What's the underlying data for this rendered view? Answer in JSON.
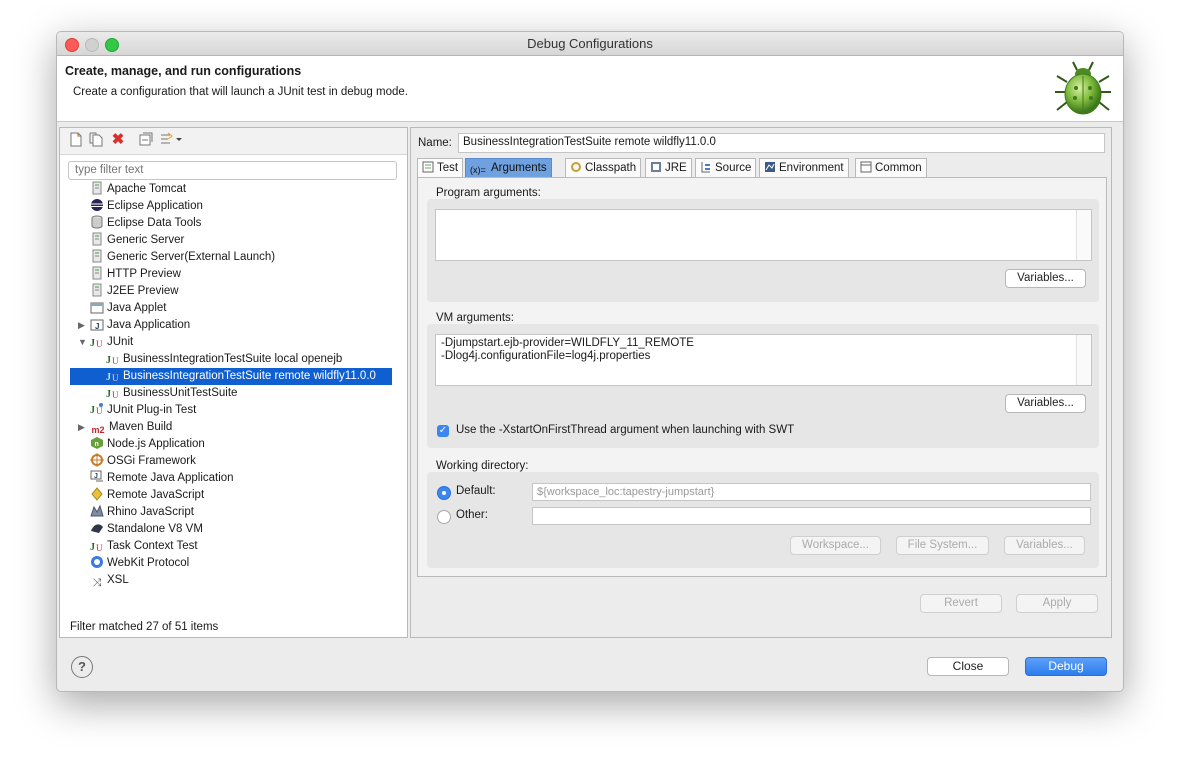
{
  "window": {
    "title": "Debug Configurations"
  },
  "header": {
    "title": "Create, manage, and run configurations",
    "description": "Create a configuration that will launch a JUnit test in debug mode."
  },
  "left": {
    "filter_placeholder": "type filter text",
    "tree": [
      {
        "label": "Apache Tomcat",
        "icon": "server-icon",
        "level": 0
      },
      {
        "label": "Eclipse Application",
        "icon": "eclipse-icon",
        "level": 0
      },
      {
        "label": "Eclipse Data Tools",
        "icon": "database-icon",
        "level": 0
      },
      {
        "label": "Generic Server",
        "icon": "server-icon",
        "level": 0
      },
      {
        "label": "Generic Server(External Launch)",
        "icon": "server-icon",
        "level": 0
      },
      {
        "label": "HTTP Preview",
        "icon": "server-icon",
        "level": 0
      },
      {
        "label": "J2EE Preview",
        "icon": "server-icon",
        "level": 0
      },
      {
        "label": "Java Applet",
        "icon": "applet-icon",
        "level": 0
      },
      {
        "label": "Java Application",
        "icon": "java-app-icon",
        "level": 0,
        "expandable": true
      },
      {
        "label": "JUnit",
        "icon": "junit-icon",
        "level": 0,
        "expanded": true
      },
      {
        "label": "BusinessIntegrationTestSuite local openejb",
        "icon": "junit-icon",
        "level": 1
      },
      {
        "label": "BusinessIntegrationTestSuite remote wildfly11.0.0",
        "icon": "junit-icon",
        "level": 1,
        "selected": true
      },
      {
        "label": "BusinessUnitTestSuite",
        "icon": "junit-icon",
        "level": 1
      },
      {
        "label": "JUnit Plug-in Test",
        "icon": "junit-plugin-icon",
        "level": 0
      },
      {
        "label": "Maven Build",
        "icon": "maven-icon",
        "level": 0,
        "expandable": true
      },
      {
        "label": "Node.js Application",
        "icon": "nodejs-icon",
        "level": 0
      },
      {
        "label": "OSGi Framework",
        "icon": "osgi-icon",
        "level": 0
      },
      {
        "label": "Remote Java Application",
        "icon": "remote-java-icon",
        "level": 0
      },
      {
        "label": "Remote JavaScript",
        "icon": "remote-js-icon",
        "level": 0
      },
      {
        "label": "Rhino JavaScript",
        "icon": "rhino-icon",
        "level": 0
      },
      {
        "label": "Standalone V8 VM",
        "icon": "v8-icon",
        "level": 0
      },
      {
        "label": "Task Context Test",
        "icon": "junit-icon",
        "level": 0
      },
      {
        "label": "WebKit Protocol",
        "icon": "webkit-icon",
        "level": 0
      },
      {
        "label": "XSL",
        "icon": "xsl-icon",
        "level": 0
      }
    ],
    "filter_status": "Filter matched 27 of 51 items"
  },
  "right": {
    "name_label": "Name:",
    "name_value": "BusinessIntegrationTestSuite remote wildfly11.0.0",
    "tabs": [
      {
        "label": "Test",
        "icon": "test-tab-icon"
      },
      {
        "label": "Arguments",
        "icon": "arguments-tab-icon",
        "active": true
      },
      {
        "label": "Classpath",
        "icon": "classpath-tab-icon"
      },
      {
        "label": "JRE",
        "icon": "jre-tab-icon"
      },
      {
        "label": "Source",
        "icon": "source-tab-icon"
      },
      {
        "label": "Environment",
        "icon": "environment-tab-icon"
      },
      {
        "label": "Common",
        "icon": "common-tab-icon"
      }
    ],
    "program_args_label": "Program arguments:",
    "program_args_value": "",
    "variables_label": "Variables...",
    "vm_args_label": "VM arguments:",
    "vm_args_value": "-Djumpstart.ejb-provider=WILDFLY_11_REMOTE\n-Dlog4j.configurationFile=log4j.properties",
    "xstart_label": "Use the -XstartOnFirstThread argument when launching with SWT",
    "working_dir_label": "Working directory:",
    "default_label": "Default:",
    "default_value": "${workspace_loc:tapestry-jumpstart}",
    "other_label": "Other:",
    "other_value": "",
    "workspace_btn": "Workspace...",
    "filesystem_btn": "File System...",
    "revert_btn": "Revert",
    "apply_btn": "Apply"
  },
  "footer": {
    "help": "?",
    "close_btn": "Close",
    "debug_btn": "Debug"
  },
  "colors": {
    "selection": "#0f5fd1",
    "active_tab": "#6fa0e0",
    "primary_button": "#2d7cef"
  }
}
